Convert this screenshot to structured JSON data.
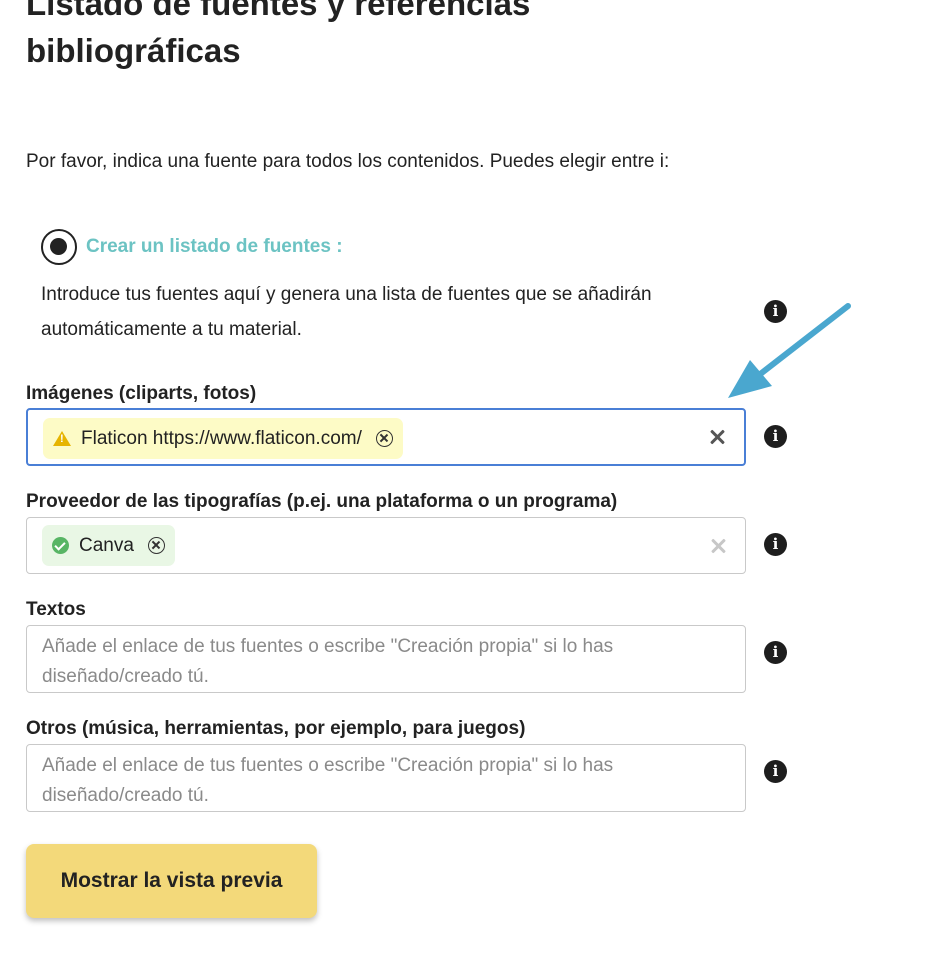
{
  "page": {
    "title": "Listado de fuentes y referencias bibliográficas",
    "intro": "Por favor, indica una fuente para todos los contenidos. Puedes elegir entre i:"
  },
  "option": {
    "label": "Crear un listado de fuentes :",
    "description": "Introduce tus fuentes aquí y genera una lista de fuentes que se añadirán automáticamente a tu material.",
    "selected": true
  },
  "fields": {
    "images": {
      "label": "Imágenes (cliparts, fotos)",
      "tag": "Flaticon https://www.flaticon.com/",
      "tag_status": "warning"
    },
    "fonts": {
      "label": "Proveedor de las tipografías (p.ej. una plataforma o un programa)",
      "tag": "Canva",
      "tag_status": "valid"
    },
    "texts": {
      "label": "Textos",
      "placeholder": "Añade el enlace de tus fuentes o escribe \"Creación propia\" si lo has diseñado/creado tú."
    },
    "others": {
      "label": "Otros (música, herramientas, por ejemplo, para juegos)",
      "placeholder": "Añade el enlace de tus fuentes o escribe \"Creación propia\" si lo has diseñado/creado tú."
    }
  },
  "buttons": {
    "preview_label": "Mostrar la vista previa"
  },
  "icons": {
    "info": "info-icon",
    "info_glyph": "i",
    "warning": "warning-icon",
    "warning_glyph": "!",
    "check": "check-icon",
    "remove": "remove-tag-icon",
    "clear": "clear-icon",
    "annotation": "arrow-annotation"
  },
  "colors": {
    "option_label": "#6cc3c3",
    "focus_border": "#4a7fd6",
    "warning_tag_bg": "#fdfbc6",
    "valid_tag_bg": "#e9f7e5",
    "button_bg": "#f3d97a",
    "arrow": "#4aa7cf"
  }
}
